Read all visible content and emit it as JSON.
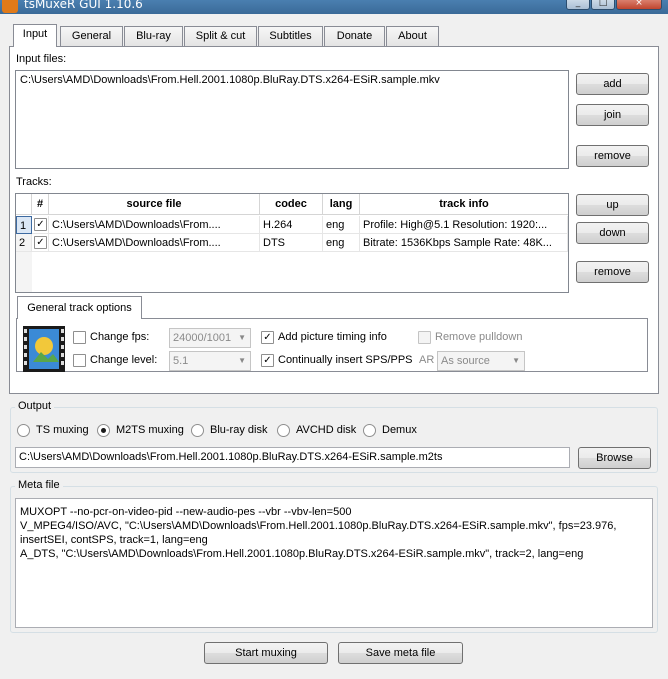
{
  "window": {
    "title": "tsMuxeR GUI 1.10.6",
    "minimize": "_",
    "maximize": "□",
    "close": "×"
  },
  "tabs": [
    "Input",
    "General",
    "Blu-ray",
    "Split & cut",
    "Subtitles",
    "Donate",
    "About"
  ],
  "input": {
    "files_label": "Input files:",
    "files": [
      "C:\\Users\\AMD\\Downloads\\From.Hell.2001.1080p.BluRay.DTS.x264-ESiR.sample.mkv"
    ],
    "add_button": "add",
    "join_button": "join",
    "remove_button": "remove"
  },
  "tracks": {
    "label": "Tracks:",
    "columns": [
      "#",
      "source file",
      "codec",
      "lang",
      "track info"
    ],
    "rows": [
      {
        "num": "1",
        "checked": true,
        "source": "C:\\Users\\AMD\\Downloads\\From....",
        "codec": "H.264",
        "lang": "eng",
        "info": "Profile: High@5.1  Resolution: 1920:..."
      },
      {
        "num": "2",
        "checked": true,
        "source": "C:\\Users\\AMD\\Downloads\\From....",
        "codec": "DTS",
        "lang": "eng",
        "info": "Bitrate: 1536Kbps  Sample Rate: 48K..."
      }
    ],
    "up_button": "up",
    "down_button": "down",
    "remove_button": "remove"
  },
  "track_options": {
    "tab_label": "General track options",
    "change_fps_label": "Change fps:",
    "fps_value": "24000/1001",
    "change_level_label": "Change level:",
    "level_value": "5.1",
    "add_picture_timing_label": "Add picture timing info",
    "add_picture_timing_checked": true,
    "continually_insert_label": "Continually insert SPS/PPS",
    "continually_insert_checked": true,
    "remove_pulldown_label": "Remove pulldown",
    "ar_label": "AR",
    "ar_value": "As source"
  },
  "output": {
    "group_label": "Output",
    "modes": [
      {
        "label": "TS muxing",
        "selected": false
      },
      {
        "label": "M2TS muxing",
        "selected": true
      },
      {
        "label": "Blu-ray disk",
        "selected": false
      },
      {
        "label": "AVCHD disk",
        "selected": false
      },
      {
        "label": "Demux",
        "selected": false
      }
    ],
    "path": "C:\\Users\\AMD\\Downloads\\From.Hell.2001.1080p.BluRay.DTS.x264-ESiR.sample.m2ts",
    "browse_button": "Browse"
  },
  "meta": {
    "group_label": "Meta file",
    "lines": [
      "MUXOPT --no-pcr-on-video-pid --new-audio-pes --vbr  --vbv-len=500",
      "V_MPEG4/ISO/AVC, \"C:\\Users\\AMD\\Downloads\\From.Hell.2001.1080p.BluRay.DTS.x264-ESiR.sample.mkv\", fps=23.976,",
      "insertSEI, contSPS, track=1, lang=eng",
      "A_DTS, \"C:\\Users\\AMD\\Downloads\\From.Hell.2001.1080p.BluRay.DTS.x264-ESiR.sample.mkv\", track=2, lang=eng"
    ]
  },
  "actions": {
    "start_button": "Start muxing",
    "save_meta_button": "Save meta file"
  }
}
